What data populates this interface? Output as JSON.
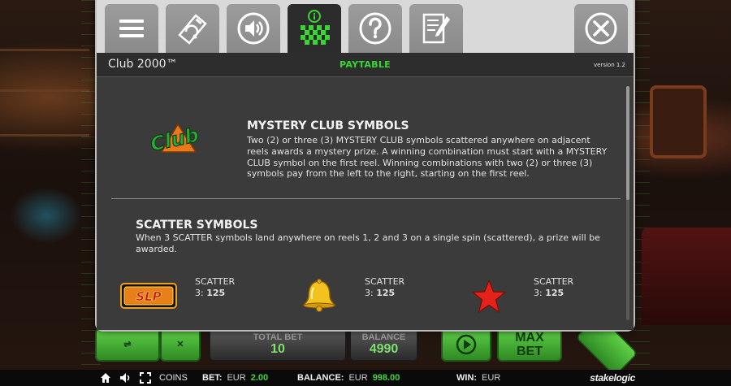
{
  "dialog": {
    "game_title": "Club 2000™",
    "section_title": "PAYTABLE",
    "version": "version 1.2",
    "tabs": [
      {
        "icon": "menu-icon",
        "active": false
      },
      {
        "icon": "autoplay-icon",
        "active": false
      },
      {
        "icon": "sound-icon",
        "active": false
      },
      {
        "icon": "paytable-icon",
        "active": true
      },
      {
        "icon": "help-icon",
        "active": false
      },
      {
        "icon": "history-icon",
        "active": false
      }
    ],
    "close_icon": "close-icon"
  },
  "paytable": {
    "mystery": {
      "title": "MYSTERY CLUB SYMBOLS",
      "text": "Two (2) or three (3) MYSTERY CLUB symbols scattered anywhere on adjacent reels awards a mystery prize. A winning combination must start with a MYSTERY CLUB symbol on the first reel. Winning combinations with two (2) or three (3) symbols pay from the left to the right, starting on the first reel.",
      "symbol_text": "Club"
    },
    "scatter": {
      "title": "SCATTER SYMBOLS",
      "text": "When 3 SCATTER symbols land anywhere on reels 1, 2 and 3 on a single spin (scattered), a prize will be awarded.",
      "items": [
        {
          "symbol": "slp-symbol",
          "symbol_text": "SLP",
          "name": "SCATTER",
          "count": "3:",
          "pay": "125"
        },
        {
          "symbol": "bell-symbol",
          "name": "SCATTER",
          "count": "3:",
          "pay": "125"
        },
        {
          "symbol": "star-symbol",
          "name": "SCATTER",
          "count": "3:",
          "pay": "125"
        }
      ]
    }
  },
  "game_controls": {
    "total_bet_label": "TOTAL BET",
    "total_bet_value": "10",
    "balance_label": "BALANCE",
    "balance_value": "4990",
    "max_bet_label_1": "MAX",
    "max_bet_label_2": "BET"
  },
  "status_bar": {
    "coins_label": "COINS",
    "bet_label": "BET:",
    "bet_currency": "EUR",
    "bet_value": "2.00",
    "balance_label": "BALANCE:",
    "balance_currency": "EUR",
    "balance_value": "998.00",
    "win_label": "WIN:",
    "win_currency": "EUR",
    "brand": "stakelogic"
  },
  "colors": {
    "accent_green": "#38d630",
    "status_green": "#3fd83a",
    "panel": "#3b3b3b",
    "tab_bar": "#d9d9d9"
  }
}
